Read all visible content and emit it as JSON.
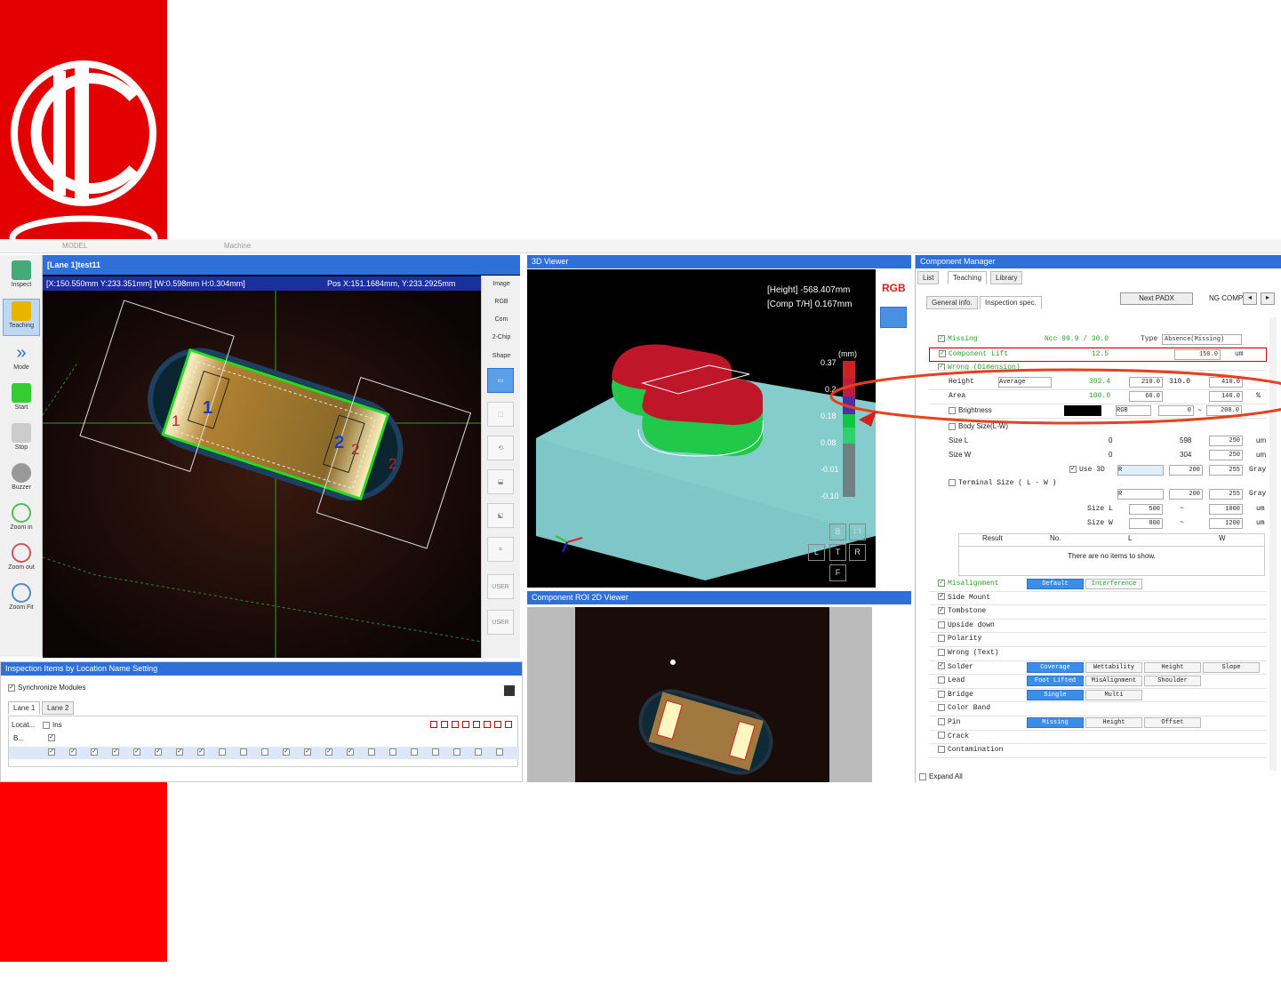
{
  "ribbon": {
    "model": "MODEL",
    "machine": "Machine"
  },
  "toolbar": {
    "items": [
      "Inspect",
      "Teaching",
      "Mode",
      "Start",
      "Stop",
      "Buzzer",
      "Zoom in",
      "Zoom out",
      "Zoom Fit"
    ]
  },
  "image_window": {
    "title": "[Lane 1]test11",
    "info": "[X:150.550mm Y:233.351mm] [W:0.598mm H:0.304mm]",
    "pos": "Pos X:151.1684mm, Y:233.2925mm",
    "labels": {
      "l1": "1",
      "l2": "2",
      "b1": "1",
      "b2": "2",
      "r2": "2"
    }
  },
  "side_tools": {
    "image": "Image",
    "rgb": "RGB",
    "com": "Com",
    "chip": "2-Chip",
    "shape": "Shape",
    "user1": "USER",
    "user2": "USER"
  },
  "viewer3d": {
    "title": "3D Viewer",
    "height": "[Height] -568.407mm",
    "comp": "[Comp T/H]  0.167mm",
    "unit": "(mm)",
    "scale": [
      "0.37",
      "0.2",
      "0.18",
      "0.08",
      "-0.01",
      "-0.10"
    ],
    "rgb": "RGB",
    "view_btns": [
      "B",
      "1:1",
      "L",
      "T",
      "R",
      "F"
    ]
  },
  "roi_viewer": {
    "title": "Component ROI 2D Viewer"
  },
  "component_manager": {
    "title": "Component Manager",
    "tabs": [
      "List",
      "Teaching",
      "Library"
    ],
    "subtabs": [
      "General info.",
      "Inspection spec."
    ],
    "next_btn": "Next PADX",
    "ng_comp": "NG COMP",
    "rows": {
      "missing": {
        "label": "Missing",
        "ncc": "Ncc 99.9 / 30.0",
        "type_label": "Type",
        "type": "Absence(Missing)"
      },
      "lift": {
        "label": "Component  Lift",
        "value": "12.5",
        "limit": "150.0",
        "unit": "um"
      },
      "wrong": {
        "label": "Wrong (Dimension)"
      },
      "height": {
        "label": "Height",
        "mode": "Average",
        "v": "302.4",
        "a": "210.0",
        "b": "310.0",
        "c": "410.0",
        "unit": "um"
      },
      "area": {
        "label": "Area",
        "v": "100.0",
        "a": "60.0",
        "c": "140.0",
        "unit": "%"
      },
      "brightness": {
        "label": "Brightness",
        "mode": "RGB",
        "a": "0",
        "sep": "~",
        "b": "200.0"
      },
      "bodysize": {
        "label": "Body Size(L-W)"
      },
      "sizel": {
        "label": "Size L",
        "a": "0",
        "b": "598",
        "c": "250",
        "unit": "um"
      },
      "sizew": {
        "label": "Size W",
        "a": "0",
        "b": "304",
        "c": "250",
        "unit": "um"
      },
      "use3d": {
        "label": "Use 3D",
        "sel": "R",
        "a": "200",
        "b": "255",
        "unit": "Gray"
      },
      "terminal": {
        "label": "Terminal Size ( L - W )",
        "sel": "R",
        "a": "200",
        "b": "255",
        "unit": "Gray"
      },
      "tsizel": {
        "label": "Size L",
        "a": "500",
        "sep": "~",
        "b": "1000",
        "unit": "um"
      },
      "tsizew": {
        "label": "Size W",
        "a": "800",
        "sep": "~",
        "b": "1200",
        "unit": "um"
      }
    },
    "result_cols": [
      "Result",
      "No.",
      "L",
      "W"
    ],
    "empty": "There are no items to show.",
    "list": [
      {
        "label": "Misalignment",
        "checked": true,
        "green": true
      },
      {
        "label": "Side Mount",
        "checked": true
      },
      {
        "label": "Tombstone",
        "checked": true
      },
      {
        "label": "Upside down",
        "checked": false
      },
      {
        "label": "Polarity",
        "checked": false
      },
      {
        "label": "Wrong (Text)",
        "checked": false
      },
      {
        "label": "Solder",
        "checked": true
      },
      {
        "label": "Lead",
        "checked": false
      },
      {
        "label": "Bridge",
        "checked": false
      },
      {
        "label": "Color Band",
        "checked": false
      },
      {
        "label": "Pin",
        "checked": false
      },
      {
        "label": "Crack",
        "checked": false
      },
      {
        "label": "Contamination",
        "checked": false
      }
    ],
    "mis_btns": [
      "Default",
      "Interference"
    ],
    "solder_btns": [
      "Coverage",
      "Wettability",
      "Height",
      "Slope"
    ],
    "lead_btns": [
      "Foot Lifted",
      "MisAlignment",
      "Shoulder"
    ],
    "bridge_btns": [
      "Single",
      "Multi"
    ],
    "pin_btns": [
      "Missing",
      "Height",
      "Offset"
    ],
    "expand": "Expand All"
  },
  "bottom": {
    "title": "Inspection Items by Location Name Setting",
    "sync": "Synchronize Modules",
    "tabs": [
      "Lane 1",
      "Lane 2"
    ],
    "loc": "Locat...",
    "ins": "Ins",
    "b": "B..."
  }
}
